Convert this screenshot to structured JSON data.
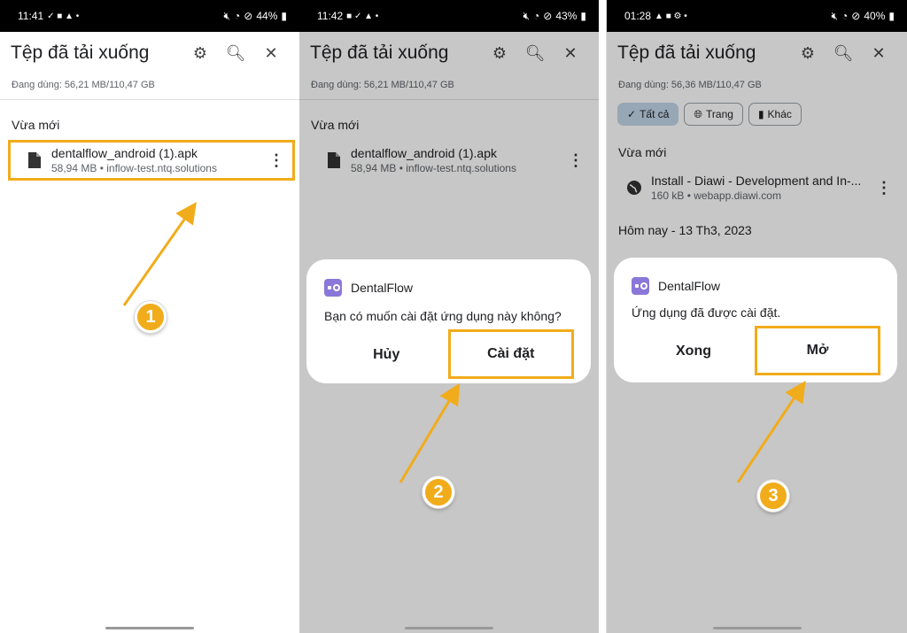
{
  "panel1": {
    "status": {
      "time": "11:41",
      "icons_left": "✓ ■ ▲ •",
      "battery": "44%"
    },
    "title": "Tệp đã tải xuống",
    "storage": "Đang dùng: 56,21 MB/110,47 GB",
    "section": "Vừa mới",
    "file": {
      "name": "dentalflow_android (1).apk",
      "meta": "58,94 MB • inflow-test.ntq.solutions"
    },
    "step": "1"
  },
  "panel2": {
    "status": {
      "time": "11:42",
      "icons_left": "■ ✓ ▲ •",
      "battery": "43%"
    },
    "title": "Tệp đã tải xuống",
    "storage": "Đang dùng: 56,21 MB/110,47 GB",
    "section": "Vừa mới",
    "file": {
      "name": "dentalflow_android (1).apk",
      "meta": "58,94 MB • inflow-test.ntq.solutions"
    },
    "dialog": {
      "app": "DentalFlow",
      "message": "Bạn có muốn cài đặt ứng dụng này không?",
      "cancel": "Hủy",
      "confirm": "Cài đặt"
    },
    "step": "2"
  },
  "panel3": {
    "status": {
      "time": "01:28",
      "icons_left": "▲ ■ ⚙ •",
      "battery": "40%"
    },
    "title": "Tệp đã tải xuống",
    "storage": "Đang dùng: 56,36 MB/110,47 GB",
    "chips": [
      {
        "label": "Tất cả",
        "icon": "check-icon"
      },
      {
        "label": "Trang",
        "icon": "globe-icon"
      },
      {
        "label": "Khác",
        "icon": "file-icon"
      }
    ],
    "section": "Vừa mới",
    "file": {
      "name": "Install - Diawi - Development and In-...",
      "meta": "160 kB • webapp.diawi.com"
    },
    "section2": "Hôm nay - 13 Th3, 2023",
    "dialog": {
      "app": "DentalFlow",
      "message": "Ứng dụng đã được cài đặt.",
      "done": "Xong",
      "open": "Mở"
    },
    "step": "3"
  },
  "colors": {
    "highlight": "#f1ac1b",
    "app_icon": "#8a78d8",
    "chip_selected": "#c2d6ea"
  }
}
